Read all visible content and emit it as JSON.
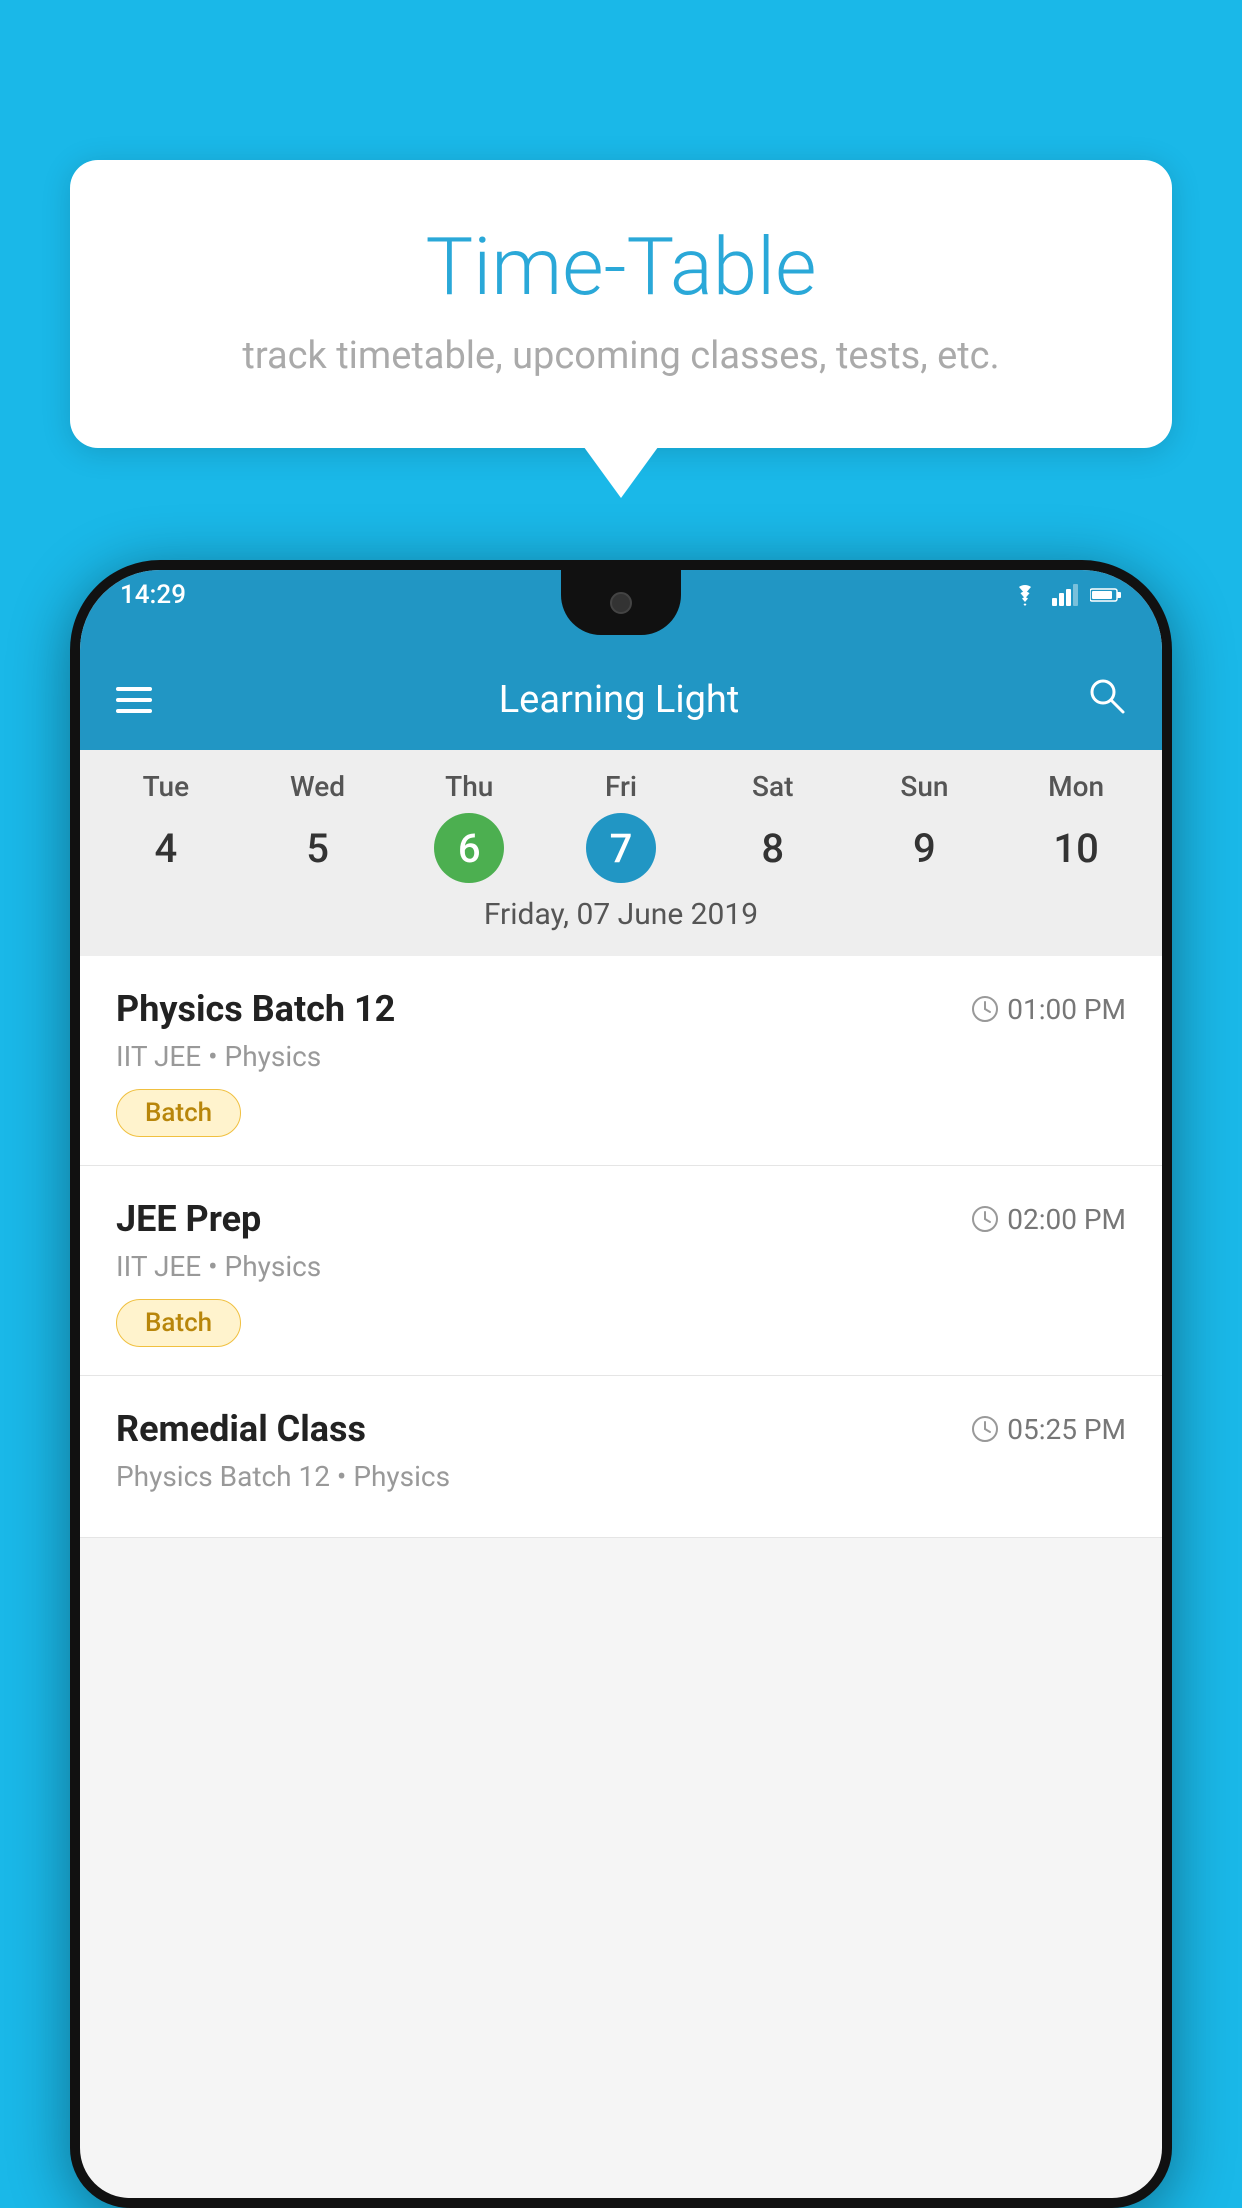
{
  "background_color": "#1ab8e8",
  "tooltip": {
    "title": "Time-Table",
    "subtitle": "track timetable, upcoming classes, tests, etc."
  },
  "status_bar": {
    "time": "14:29",
    "icons": [
      "wifi",
      "signal",
      "battery"
    ]
  },
  "app_bar": {
    "title": "Learning Light",
    "search_icon_label": "search"
  },
  "calendar": {
    "days": [
      {
        "name": "Tue",
        "num": "4",
        "state": "normal"
      },
      {
        "name": "Wed",
        "num": "5",
        "state": "normal"
      },
      {
        "name": "Thu",
        "num": "6",
        "state": "today"
      },
      {
        "name": "Fri",
        "num": "7",
        "state": "selected"
      },
      {
        "name": "Sat",
        "num": "8",
        "state": "normal"
      },
      {
        "name": "Sun",
        "num": "9",
        "state": "normal"
      },
      {
        "name": "Mon",
        "num": "10",
        "state": "normal"
      }
    ],
    "selected_date_label": "Friday, 07 June 2019"
  },
  "schedule": [
    {
      "title": "Physics Batch 12",
      "time": "01:00 PM",
      "subtitle": "IIT JEE • Physics",
      "badge": "Batch"
    },
    {
      "title": "JEE Prep",
      "time": "02:00 PM",
      "subtitle": "IIT JEE • Physics",
      "badge": "Batch"
    },
    {
      "title": "Remedial Class",
      "time": "05:25 PM",
      "subtitle": "Physics Batch 12 • Physics",
      "badge": null
    }
  ],
  "labels": {
    "hamburger": "menu",
    "search": "search",
    "batch_badge": "Batch"
  }
}
